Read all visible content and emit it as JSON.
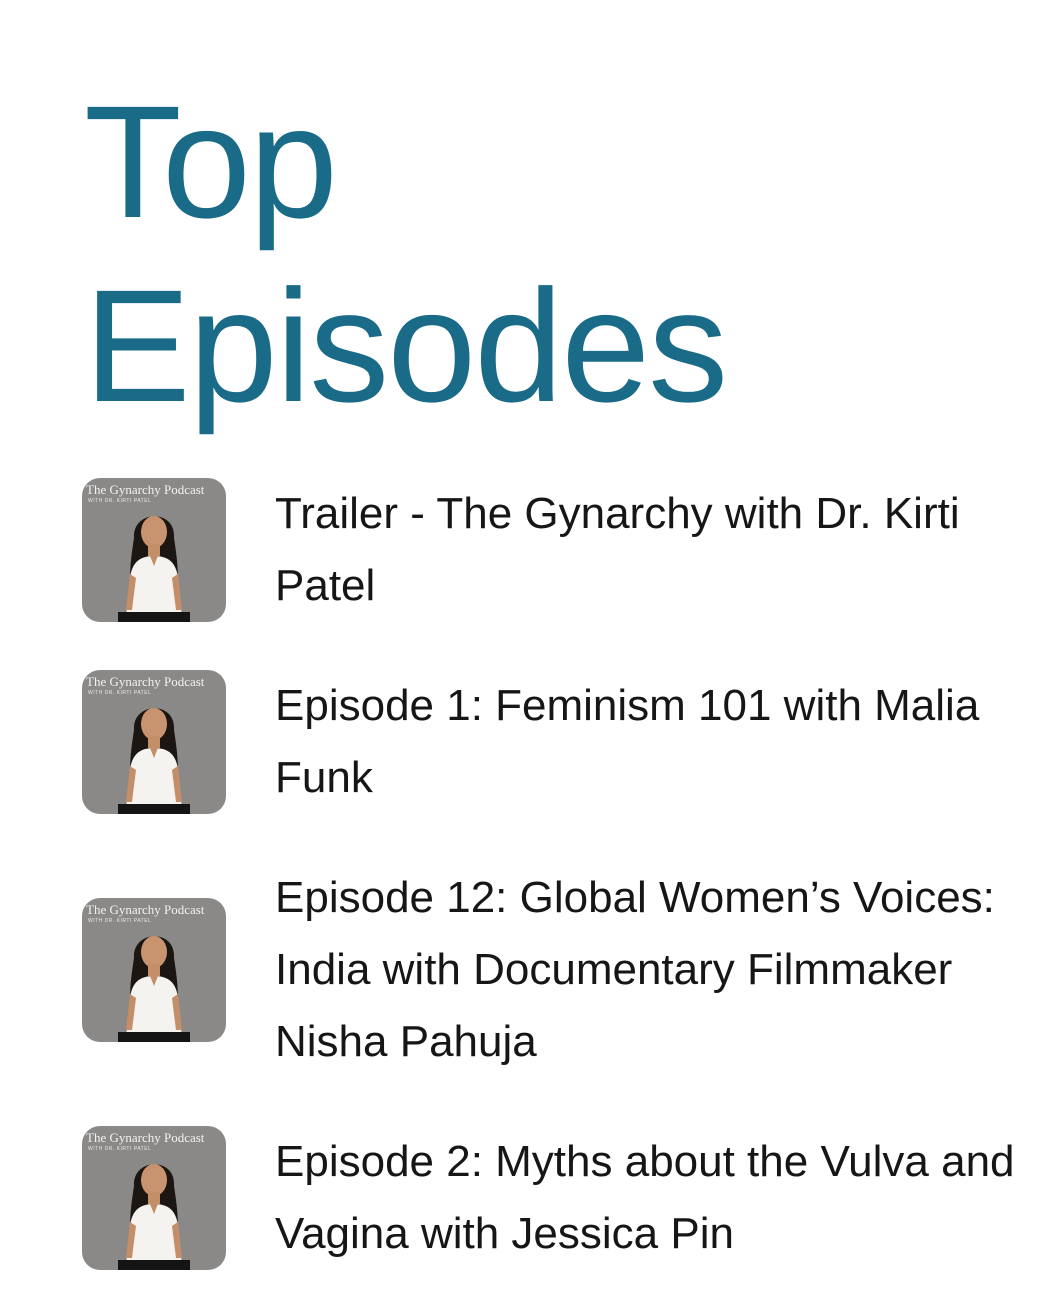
{
  "header": {
    "title_line1": "Top",
    "title_line2": "Episodes"
  },
  "colors": {
    "title": "#1a6b87",
    "text": "#161616",
    "artwork_bg": "#8a8987"
  },
  "artwork": {
    "podcast_name": "The Gynarchy Podcast",
    "host_line": "WITH DR. KIRTI PATEL",
    "icon": "podcast-artwork"
  },
  "episodes": [
    {
      "title": "Trailer - The Gynarchy with Dr. Kirti Patel"
    },
    {
      "title": "Episode 1: Feminism 101 with Malia Funk"
    },
    {
      "title": "Episode 12: Global Women’s Voices: India with Documentary Filmmaker Nisha Pahuja"
    },
    {
      "title": "Episode 2: Myths about the Vulva and Vagina with Jessica Pin"
    }
  ]
}
